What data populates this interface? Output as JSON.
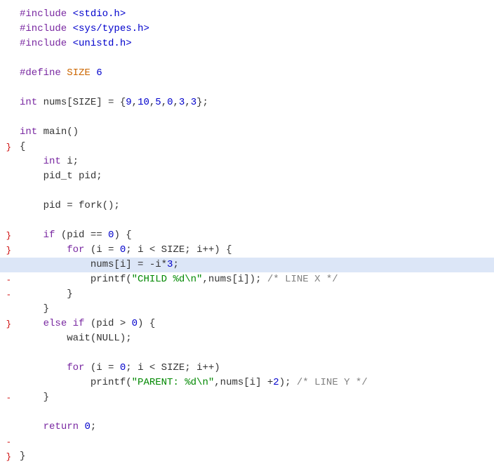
{
  "code": {
    "lines": [
      {
        "gutter": "",
        "highlight": false,
        "tokens": [
          {
            "c": "pp",
            "t": "#include "
          },
          {
            "c": "inc",
            "t": "<stdio.h>"
          }
        ]
      },
      {
        "gutter": "",
        "highlight": false,
        "tokens": [
          {
            "c": "pp",
            "t": "#include "
          },
          {
            "c": "inc",
            "t": "<sys/types.h>"
          }
        ]
      },
      {
        "gutter": "",
        "highlight": false,
        "tokens": [
          {
            "c": "pp",
            "t": "#include "
          },
          {
            "c": "inc",
            "t": "<unistd.h>"
          }
        ]
      },
      {
        "gutter": "",
        "highlight": false,
        "tokens": []
      },
      {
        "gutter": "",
        "highlight": false,
        "tokens": [
          {
            "c": "def-kw",
            "t": "#define "
          },
          {
            "c": "def-name",
            "t": "SIZE "
          },
          {
            "c": "def-val",
            "t": "6"
          }
        ]
      },
      {
        "gutter": "",
        "highlight": false,
        "tokens": []
      },
      {
        "gutter": "",
        "highlight": false,
        "tokens": [
          {
            "c": "kw",
            "t": "int"
          },
          {
            "c": "plain",
            "t": " nums[SIZE] = {"
          },
          {
            "c": "num",
            "t": "9"
          },
          {
            "c": "plain",
            "t": ","
          },
          {
            "c": "num",
            "t": "10"
          },
          {
            "c": "plain",
            "t": ","
          },
          {
            "c": "num",
            "t": "5"
          },
          {
            "c": "plain",
            "t": ","
          },
          {
            "c": "num",
            "t": "0"
          },
          {
            "c": "plain",
            "t": ","
          },
          {
            "c": "num",
            "t": "3"
          },
          {
            "c": "plain",
            "t": ","
          },
          {
            "c": "num",
            "t": "3"
          },
          {
            "c": "plain",
            "t": "};"
          }
        ]
      },
      {
        "gutter": "",
        "highlight": false,
        "tokens": []
      },
      {
        "gutter": "",
        "highlight": false,
        "tokens": [
          {
            "c": "kw",
            "t": "int"
          },
          {
            "c": "plain",
            "t": " main()"
          }
        ]
      },
      {
        "gutter": "}",
        "highlight": false,
        "tokens": [
          {
            "c": "plain",
            "t": "{"
          }
        ]
      },
      {
        "gutter": "",
        "highlight": false,
        "tokens": [
          {
            "c": "plain",
            "t": "    "
          },
          {
            "c": "kw",
            "t": "int"
          },
          {
            "c": "plain",
            "t": " i;"
          }
        ]
      },
      {
        "gutter": "",
        "highlight": false,
        "tokens": [
          {
            "c": "plain",
            "t": "    pid_t pid;"
          }
        ]
      },
      {
        "gutter": "",
        "highlight": false,
        "tokens": []
      },
      {
        "gutter": "",
        "highlight": false,
        "tokens": [
          {
            "c": "plain",
            "t": "    pid = fork();"
          }
        ]
      },
      {
        "gutter": "",
        "highlight": false,
        "tokens": []
      },
      {
        "gutter": "}",
        "highlight": false,
        "tokens": [
          {
            "c": "plain",
            "t": "    "
          },
          {
            "c": "kw",
            "t": "if"
          },
          {
            "c": "plain",
            "t": " (pid == "
          },
          {
            "c": "num",
            "t": "0"
          },
          {
            "c": "plain",
            "t": ") {"
          }
        ]
      },
      {
        "gutter": "}",
        "highlight": false,
        "tokens": [
          {
            "c": "plain",
            "t": "        "
          },
          {
            "c": "kw",
            "t": "for"
          },
          {
            "c": "plain",
            "t": " (i = "
          },
          {
            "c": "num",
            "t": "0"
          },
          {
            "c": "plain",
            "t": "; i < SIZE; i++) {"
          }
        ]
      },
      {
        "gutter": "",
        "highlight": true,
        "tokens": [
          {
            "c": "plain",
            "t": "            nums[i] = -i*"
          },
          {
            "c": "num",
            "t": "3"
          },
          {
            "c": "plain",
            "t": ";"
          }
        ]
      },
      {
        "gutter": "-",
        "highlight": false,
        "tokens": [
          {
            "c": "plain",
            "t": "            printf("
          },
          {
            "c": "str",
            "t": "\"CHILD %d\\n\""
          },
          {
            "c": "plain",
            "t": ",nums[i]); "
          },
          {
            "c": "cmt",
            "t": "/* LINE X */"
          }
        ]
      },
      {
        "gutter": "-",
        "highlight": false,
        "tokens": [
          {
            "c": "plain",
            "t": "        }"
          }
        ]
      },
      {
        "gutter": "",
        "highlight": false,
        "tokens": [
          {
            "c": "plain",
            "t": "    }"
          }
        ]
      },
      {
        "gutter": "}",
        "highlight": false,
        "tokens": [
          {
            "c": "plain",
            "t": "    "
          },
          {
            "c": "kw",
            "t": "else if"
          },
          {
            "c": "plain",
            "t": " (pid > "
          },
          {
            "c": "num",
            "t": "0"
          },
          {
            "c": "plain",
            "t": ") {"
          }
        ]
      },
      {
        "gutter": "",
        "highlight": false,
        "tokens": [
          {
            "c": "plain",
            "t": "        wait(NULL);"
          }
        ]
      },
      {
        "gutter": "",
        "highlight": false,
        "tokens": []
      },
      {
        "gutter": "",
        "highlight": false,
        "tokens": [
          {
            "c": "plain",
            "t": "        "
          },
          {
            "c": "kw",
            "t": "for"
          },
          {
            "c": "plain",
            "t": " (i = "
          },
          {
            "c": "num",
            "t": "0"
          },
          {
            "c": "plain",
            "t": "; i < SIZE; i++)"
          }
        ]
      },
      {
        "gutter": "",
        "highlight": false,
        "tokens": [
          {
            "c": "plain",
            "t": "            printf("
          },
          {
            "c": "str",
            "t": "\"PARENT: %d\\n\""
          },
          {
            "c": "plain",
            "t": ",nums[i] +"
          },
          {
            "c": "num",
            "t": "2"
          },
          {
            "c": "plain",
            "t": "); "
          },
          {
            "c": "cmt",
            "t": "/* LINE Y */"
          }
        ]
      },
      {
        "gutter": "-",
        "highlight": false,
        "tokens": [
          {
            "c": "plain",
            "t": "    }"
          }
        ]
      },
      {
        "gutter": "",
        "highlight": false,
        "tokens": []
      },
      {
        "gutter": "",
        "highlight": false,
        "tokens": [
          {
            "c": "plain",
            "t": "    "
          },
          {
            "c": "kw",
            "t": "return"
          },
          {
            "c": "plain",
            "t": " "
          },
          {
            "c": "num",
            "t": "0"
          },
          {
            "c": "plain",
            "t": ";"
          }
        ]
      },
      {
        "gutter": "-",
        "highlight": false,
        "tokens": []
      },
      {
        "gutter": "}",
        "highlight": false,
        "tokens": [
          {
            "c": "plain",
            "t": "}"
          }
        ]
      }
    ]
  }
}
